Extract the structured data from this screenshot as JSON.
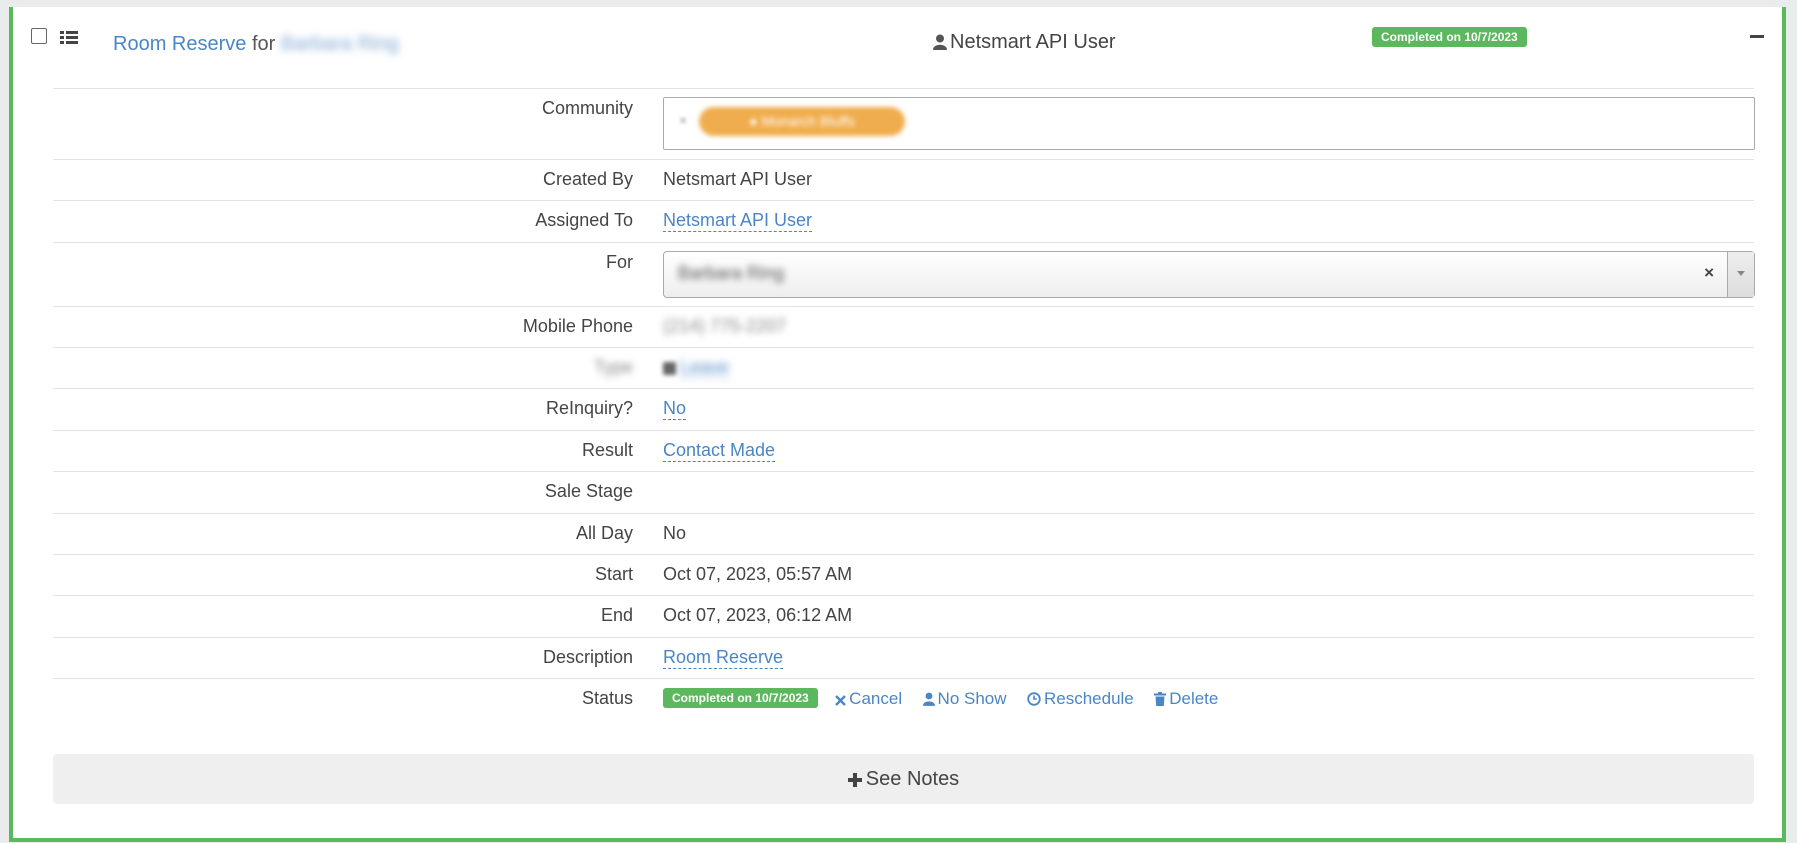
{
  "header": {
    "title_link": "Room Reserve",
    "for_word": "for",
    "for_name": "Barbara Ring",
    "owner": "Netsmart API User",
    "status_badge": "Completed on 10/7/2023"
  },
  "fields": {
    "community": {
      "label": "Community",
      "chip": "Monarch Bluffs",
      "chip_remove": "×"
    },
    "created_by": {
      "label": "Created By",
      "value": "Netsmart API User"
    },
    "assigned_to": {
      "label": "Assigned To",
      "value": "Netsmart API User"
    },
    "for": {
      "label": "For",
      "value": "Barbara Ring",
      "clear": "×"
    },
    "mobile_phone": {
      "label": "Mobile Phone",
      "value": "(214) 775-2207"
    },
    "type": {
      "label": "Type",
      "value": "Leave"
    },
    "reinquiry": {
      "label": "ReInquiry?",
      "value": "No"
    },
    "result": {
      "label": "Result",
      "value": "Contact Made"
    },
    "sale_stage": {
      "label": "Sale Stage",
      "value": ""
    },
    "all_day": {
      "label": "All Day",
      "value": "No"
    },
    "start": {
      "label": "Start",
      "value": "Oct 07, 2023, 05:57 AM"
    },
    "end": {
      "label": "End",
      "value": "Oct 07, 2023, 06:12 AM"
    },
    "description": {
      "label": "Description",
      "value": "Room Reserve"
    },
    "status": {
      "label": "Status",
      "badge": "Completed on 10/7/2023",
      "actions": {
        "cancel": "Cancel",
        "no_show": "No Show",
        "reschedule": "Reschedule",
        "delete": "Delete"
      }
    }
  },
  "footer": {
    "see_notes": "See Notes"
  },
  "colors": {
    "success": "#5cb85c",
    "link": "#4a86c5",
    "chip": "#f0ad4e"
  }
}
